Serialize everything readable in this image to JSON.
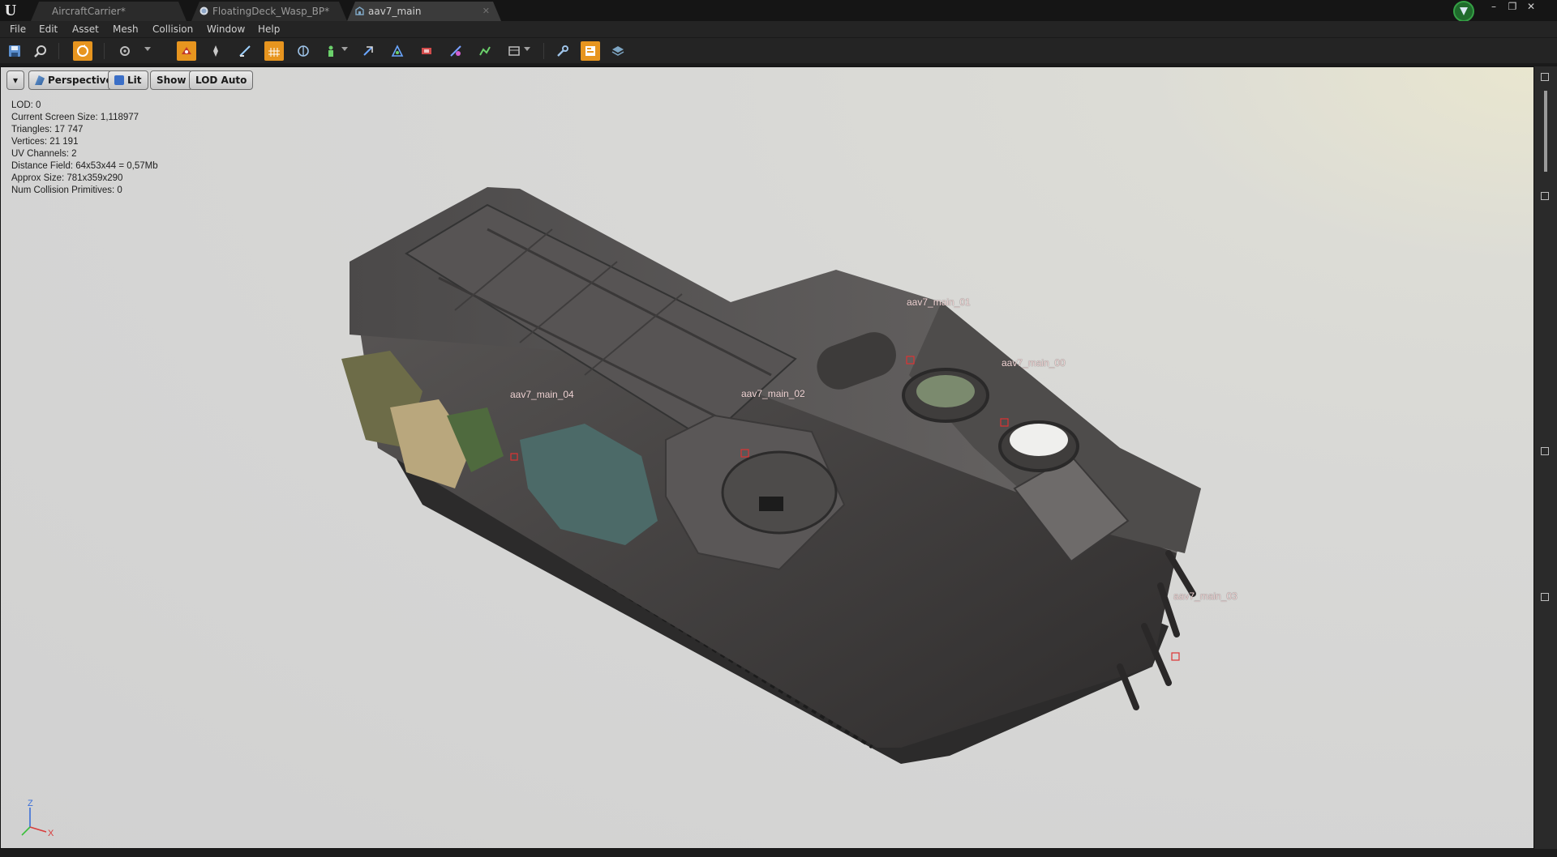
{
  "app": {
    "logo": "U"
  },
  "tabs": [
    {
      "label": "AircraftCarrier*",
      "icon": "level-icon",
      "active": false
    },
    {
      "label": "FloatingDeck_Wasp_BP*",
      "icon": "blueprint-icon",
      "active": false
    },
    {
      "label": "aav7_main",
      "icon": "static-mesh-icon",
      "active": true,
      "close": "✕"
    }
  ],
  "window_controls": {
    "minimize": "–",
    "restore": "❐",
    "close": "✕"
  },
  "menu": [
    "File",
    "Edit",
    "Asset",
    "Mesh",
    "Collision",
    "Window",
    "Help"
  ],
  "toolbar_icons": [
    "save-icon",
    "browse-icon",
    "reimport-icon",
    "camera-icon",
    "sockets-icon",
    "pivot-icon",
    "normals-icon",
    "grid-icon",
    "bounds-icon",
    "collision-icon",
    "simple-collision-icon",
    "complex-collision-icon",
    "uv-icon",
    "vertex-color-icon",
    "lod-icon",
    "secondary-icon",
    "properties-icon",
    "layers-icon"
  ],
  "viewport": {
    "menu_arrow": "▾",
    "perspective": "Perspective",
    "lit": "Lit",
    "show": "Show",
    "lod": "LOD Auto"
  },
  "stats": [
    "LOD:  0",
    "Current Screen Size:  1,118977",
    "Triangles:  17 747",
    "Vertices:  21 191",
    "UV Channels:  2",
    "Distance Field:  64x53x44 = 0,57Mb",
    "Approx Size: 781x359x290",
    "Num Collision Primitives:  0"
  ],
  "sockets": [
    "aav7_main_04",
    "aav7_main_02",
    "aav7_main_01",
    "aav7_main_00",
    "aav7_main_03"
  ],
  "axis": {
    "z": "Z",
    "x": "X"
  },
  "colors": {
    "accent_orange": "#e7951f",
    "viewport_bg": "#d6d6d4",
    "hull": "#4a4848",
    "socket_text": "#f3d6d6"
  }
}
